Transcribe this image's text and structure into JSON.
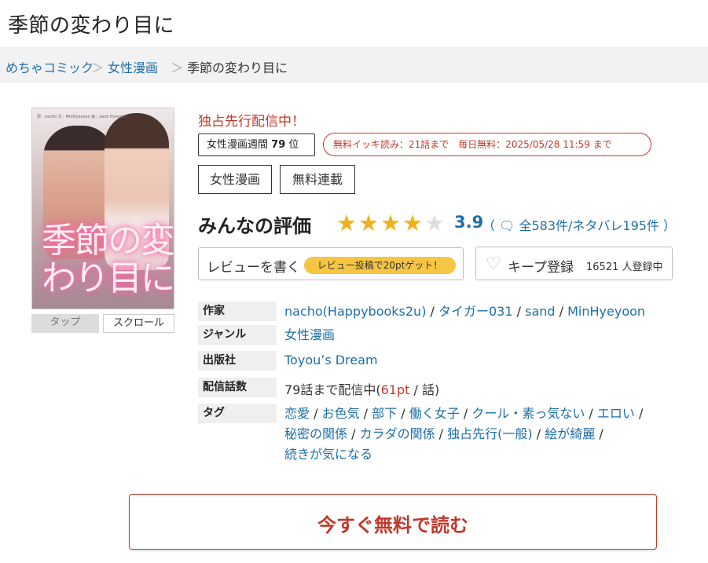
{
  "title": "季節の変わり目に",
  "breadcrumb": {
    "home": "めちゃコミック",
    "category": "女性漫画",
    "current": "季節の変わり目に",
    "separator": "＞"
  },
  "cover": {
    "title": "季節の変わり目に",
    "small_text": "原：nacho\n文：MinHyeyoon\n画：sand Hyeyoon"
  },
  "view_modes": {
    "tap": "タップ",
    "scroll": "スクロール"
  },
  "exclusive_label": "独占先行配信中！",
  "ranking": {
    "prefix": "女性漫画週間",
    "rank": "79",
    "suffix": "位"
  },
  "free_info": "無料イッキ読み：21話まで　毎日無料：2025/05/28 11:59 まで",
  "genre_tags": [
    "女性漫画",
    "無料連載"
  ],
  "rating": {
    "label": "みんなの評価",
    "value": "3.9",
    "stars_filled": 4,
    "stars_total": 5,
    "counts": "（ 🗨 全583件/ネタバレ195件 ）"
  },
  "review_button": {
    "label": "レビューを書く",
    "bonus": "レビュー投稿で20ptゲット！"
  },
  "keep_button": {
    "heart_icon": "♡",
    "label": "キープ登録",
    "count": "16521 人登録中"
  },
  "info": {
    "author_label": "作家",
    "authors": [
      "nacho(Happybooks2u)",
      "タイガー031",
      "sand",
      "MinHyeyoon"
    ],
    "genre_label": "ジャンル",
    "genre": "女性漫画",
    "publisher_label": "出版社",
    "publisher": "Toyou’s Dream",
    "episodes_label": "配信話数",
    "episodes_prefix": "79話まで配信中(",
    "episodes_pt": "61pt",
    "episodes_suffix": " / 話)",
    "tags_label": "タグ",
    "tags": [
      "恋愛",
      "お色気",
      "部下",
      "働く女子",
      "クール・素っ気ない",
      "エロい",
      "秘密の関係",
      "カラダの関係",
      "独占先行(一般)",
      "絵が綺麗",
      "続きが気になる"
    ]
  },
  "read_button": "今すぐ無料で読む",
  "colors": {
    "link": "#1e6fa8",
    "accent": "#c0392b",
    "star": "#f0b21c",
    "bonus": "#f5c543"
  }
}
